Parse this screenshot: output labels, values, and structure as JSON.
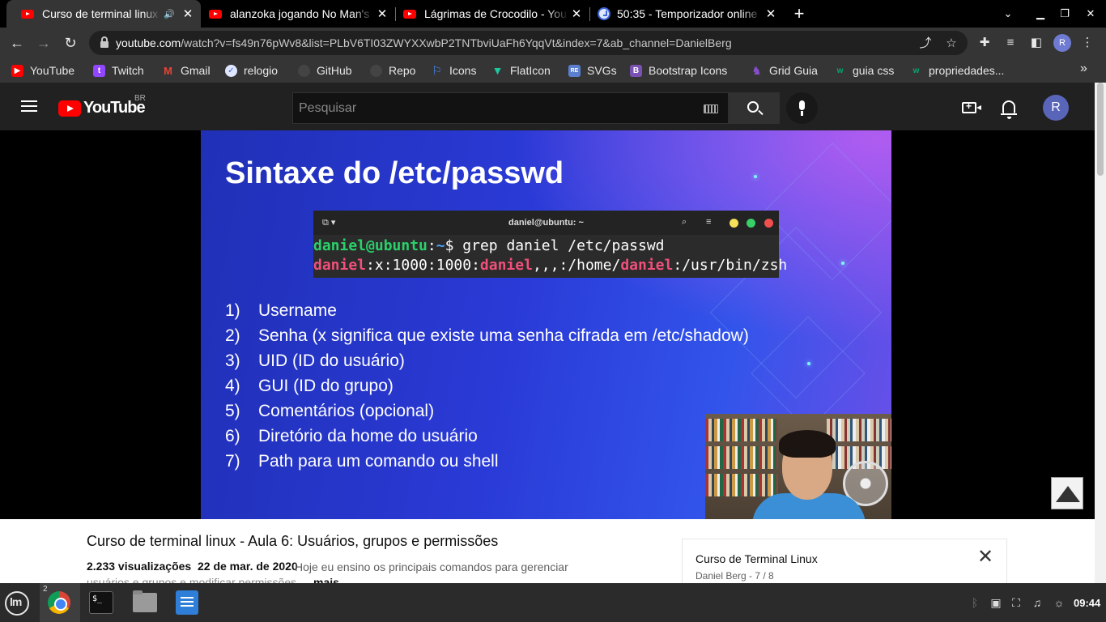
{
  "browser": {
    "tabs": [
      {
        "title": "Curso de terminal linux - Aula 6: Usuários, grupos e permissões",
        "favicon": "youtube-icon",
        "active": true,
        "audio": true
      },
      {
        "title": "alanzoka jogando No Man's Sky",
        "favicon": "youtube-icon",
        "active": false
      },
      {
        "title": "Lágrimas de Crocodilo - YouTube",
        "favicon": "youtube-icon",
        "active": false
      },
      {
        "title": "50:35 - Temporizador online",
        "favicon": "clock-icon",
        "active": false
      }
    ],
    "close_glyph": "✕",
    "new_tab_glyph": "+",
    "url_host": "youtube.com",
    "url_path": "/watch?v=fs49n76pWv8&list=PLbV6TI03ZWYXXwbP2TNTbviUaFh6YqqVt&index=7&ab_channel=DanielBerg",
    "profile_initial": "R"
  },
  "bookmarks": [
    {
      "label": "YouTube",
      "icon": "youtube-icon",
      "color": "#ff0000"
    },
    {
      "label": "Twitch",
      "icon": "twitch-icon",
      "color": "#9146ff"
    },
    {
      "label": "Gmail",
      "icon": "gmail-icon",
      "color": "#ea4335"
    },
    {
      "label": "relogio",
      "icon": "clock-icon",
      "color": "#3c64d6"
    },
    {
      "label": "GitHub",
      "icon": "github-icon",
      "color": "#444444"
    },
    {
      "label": "Repo",
      "icon": "github-icon",
      "color": "#444444"
    },
    {
      "label": "Icons",
      "icon": "flag-icon",
      "color": "#4c8ef7"
    },
    {
      "label": "FlatIcon",
      "icon": "flaticon-icon",
      "color": "#1ec7a0"
    },
    {
      "label": "SVGs",
      "icon": "svgrepo-icon",
      "color": "#5a7fd0"
    },
    {
      "label": "Bootstrap Icons",
      "icon": "bootstrap-icon",
      "color": "#7952b3"
    },
    {
      "label": "Grid Guia",
      "icon": "grid-guide-icon",
      "color": "#8a4fd0"
    },
    {
      "label": "guia css",
      "icon": "w3-icon",
      "color": "#04aa6d"
    },
    {
      "label": "propriedades...",
      "icon": "w3-icon",
      "color": "#04aa6d"
    }
  ],
  "youtube": {
    "region": "BR",
    "logo_text": "YouTube",
    "search_placeholder": "Pesquisar",
    "avatar_initial": "R"
  },
  "slide": {
    "title": "Sintaxe do /etc/passwd",
    "terminal": {
      "window_title": "daniel@ubuntu: ~",
      "prompt_user": "daniel@ubuntu",
      "prompt_sep": ":",
      "prompt_path": "~",
      "prompt_dollar": "$ ",
      "command": "grep daniel /etc/passwd",
      "out_user": "daniel",
      "out_fields": ":x:1000:1000:",
      "out_gecos": "daniel",
      "out_commas": ",,,:/home/",
      "out_home_user": "daniel",
      "out_shell": ":/usr/bin/zsh"
    },
    "items": [
      {
        "num": "1)",
        "text": "Username"
      },
      {
        "num": "2)",
        "text": "Senha (x significa que existe uma senha cifrada em /etc/shadow)"
      },
      {
        "num": "3)",
        "text": "UID (ID do usuário)"
      },
      {
        "num": "4)",
        "text": "GUI (ID do grupo)"
      },
      {
        "num": "5)",
        "text": "Comentários (opcional)"
      },
      {
        "num": "6)",
        "text": "Diretório da home do usuário"
      },
      {
        "num": "7)",
        "text": "Path para um comando ou shell"
      }
    ]
  },
  "video": {
    "title": "Curso de terminal linux - Aula 6: Usuários, grupos e permissões",
    "views": "2.233 visualizações",
    "date": "22 de mar. de 2020",
    "description_line1": "Hoje eu ensino os principais comandos para gerenciar",
    "description_line2": "usuários e grupos e modificar permissões...",
    "more_label": "mais"
  },
  "playlist": {
    "title": "Curso de Terminal Linux",
    "subtitle": "Daniel Berg - 7 / 8",
    "close_glyph": "✕"
  },
  "taskbar": {
    "chrome_badge": "2",
    "terminal_glyph": "$_",
    "time": "09:44"
  }
}
